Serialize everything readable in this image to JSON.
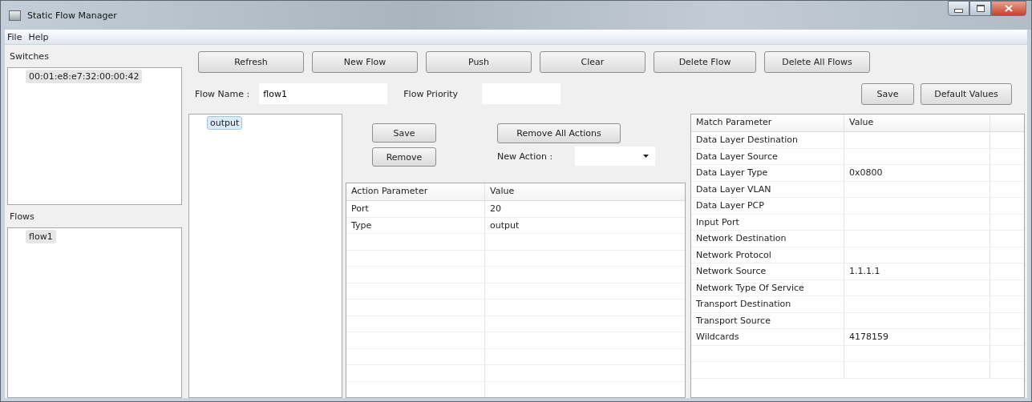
{
  "window": {
    "title": "Static Flow Manager"
  },
  "menu": [
    "File",
    "Help"
  ],
  "switches": {
    "label": "Switches",
    "focused": false,
    "items": [
      {
        "text": "00:01:e8:e7:32:00:00:42",
        "selected": true
      }
    ]
  },
  "flows": {
    "label": "Flows",
    "focused": false,
    "items": [
      {
        "text": "flow1",
        "selected": true
      }
    ]
  },
  "toolbar": [
    "Refresh",
    "New Flow",
    "Push",
    "Clear",
    "Delete Flow",
    "Delete All Flows"
  ],
  "flow_name": {
    "label": "Flow Name :",
    "value": "flow1"
  },
  "flow_priority": {
    "label": "Flow Priority"
  },
  "match_buttons": [
    "Save",
    "Default Values"
  ],
  "actions": {
    "focused": true,
    "items": [
      {
        "text": "output",
        "selected": true
      }
    ]
  },
  "action_buttons": {
    "save": "Save",
    "remove": "Remove",
    "remove_all": "Remove All Actions"
  },
  "new_action": {
    "label": "New Action :"
  },
  "action_table": {
    "columns": [
      "Action Parameter",
      "Value"
    ],
    "rows": [
      [
        "Port",
        "20"
      ],
      [
        "Type",
        "output"
      ]
    ]
  },
  "match_table": {
    "columns": [
      "Match Parameter",
      "Value"
    ],
    "rows": [
      [
        "Data Layer Destination",
        ""
      ],
      [
        "Data Layer Source",
        ""
      ],
      [
        "Data Layer Type",
        "0x0800"
      ],
      [
        "Data Layer VLAN",
        ""
      ],
      [
        "Data Layer PCP",
        ""
      ],
      [
        "Input Port",
        ""
      ],
      [
        "Network Destination",
        ""
      ],
      [
        "Network Protocol",
        ""
      ],
      [
        "Network Source",
        "1.1.1.1"
      ],
      [
        "Network Type Of Service",
        ""
      ],
      [
        "Transport Destination",
        ""
      ],
      [
        "Transport Source",
        ""
      ],
      [
        "Wildcards",
        "4178159"
      ]
    ]
  }
}
